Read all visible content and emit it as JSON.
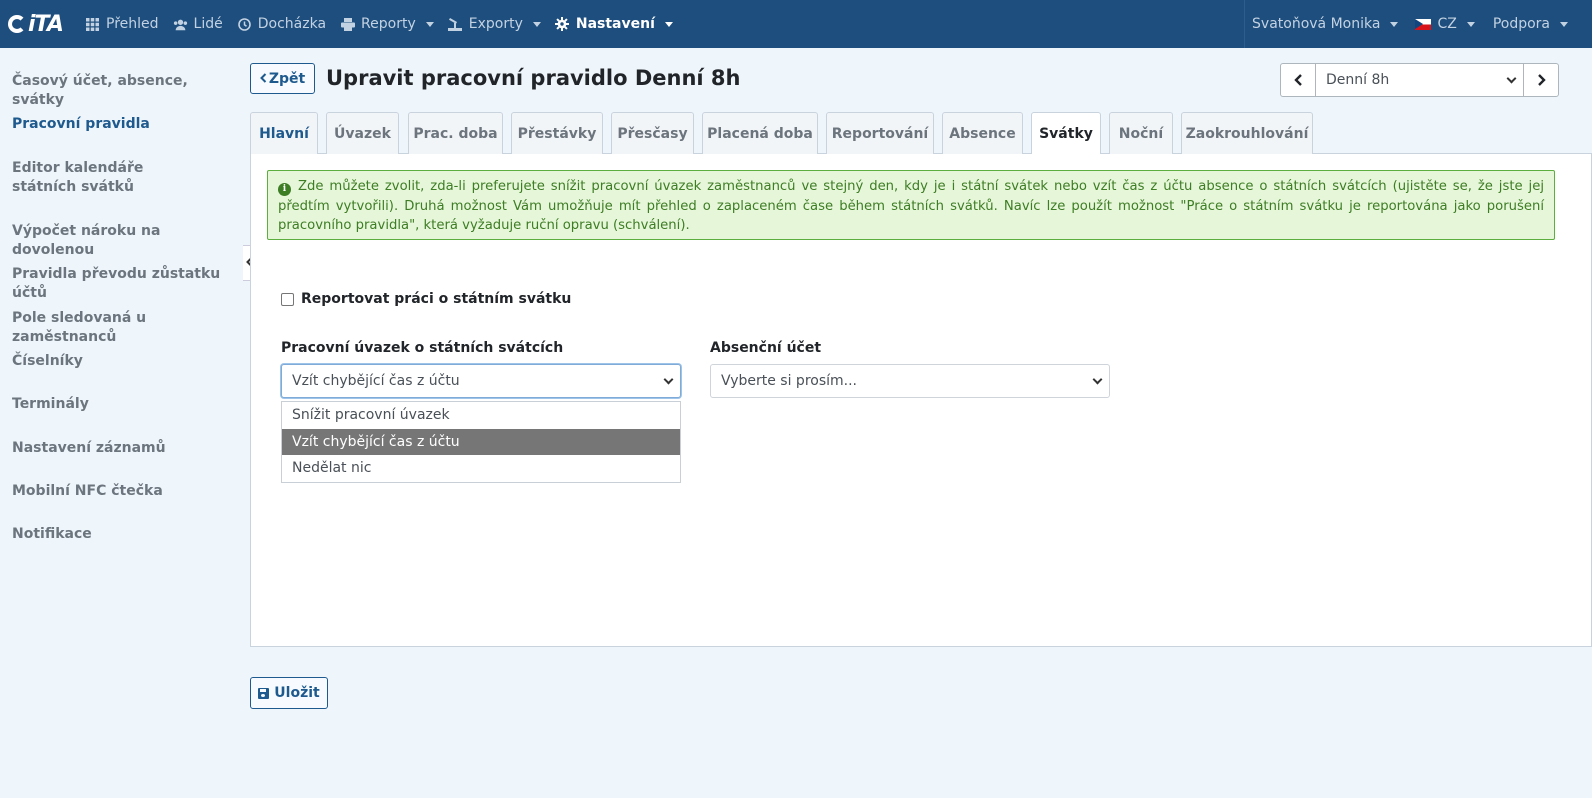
{
  "app": {
    "logo_text": "iTA"
  },
  "navbar": {
    "items": [
      {
        "label": "Přehled",
        "icon": "grid-icon"
      },
      {
        "label": "Lidé",
        "icon": "users-icon"
      },
      {
        "label": "Docházka",
        "icon": "clock-icon"
      },
      {
        "label": "Reporty",
        "icon": "printer-icon"
      },
      {
        "label": "Exporty",
        "icon": "export-icon"
      },
      {
        "label": "Nastavení",
        "icon": "gear-icon"
      }
    ],
    "user": "Svatoňová Monika",
    "language": "CZ",
    "support": "Podpora"
  },
  "sidebar": {
    "items": [
      {
        "label": "Časový účet, absence, svátky"
      },
      {
        "label": "Pracovní pravidla"
      },
      {
        "label": "Editor kalendáře státních svátků"
      },
      {
        "label": "Výpočet nároku na dovolenou"
      },
      {
        "label": "Pravidla převodu zůstatku účtů"
      },
      {
        "label": "Pole sledovaná u zaměstnanců"
      },
      {
        "label": "Číselníky"
      },
      {
        "label": "Terminály"
      },
      {
        "label": "Nastavení záznamů"
      },
      {
        "label": "Mobilní NFC čtečka"
      },
      {
        "label": "Notifikace"
      }
    ]
  },
  "header": {
    "back_label": "Zpět",
    "title": "Upravit pracovní pravidlo Denní 8h",
    "rule_select_value": "Denní 8h"
  },
  "tabs": [
    {
      "label": "Hlavní"
    },
    {
      "label": "Úvazek"
    },
    {
      "label": "Prac. doba"
    },
    {
      "label": "Přestávky"
    },
    {
      "label": "Přesčasy"
    },
    {
      "label": "Placená doba"
    },
    {
      "label": "Reportování"
    },
    {
      "label": "Absence"
    },
    {
      "label": "Svátky"
    },
    {
      "label": "Noční"
    },
    {
      "label": "Zaokrouhlování"
    }
  ],
  "active_tab": "Svátky",
  "panel": {
    "info_text": "Zde můžete zvolit, zda-li preferujete snížit pracovní úvazek zaměstnanců ve stejný den, kdy je i státní svátek nebo vzít čas z účtu absence o státních svátcích (ujistěte se, že jste jej předtím vytvořili). Druhá možnost Vám umožňuje mít přehled o zaplaceném čase během státních svátků. Navíc lze použít možnost \"Práce o státním svátku je reportována jako porušení pracovního pravidla\", která vyžaduje ruční opravu (schválení).",
    "checkbox_label": "Reportovat práci o státním svátku",
    "checkbox_checked": false,
    "workload_label": "Pracovní úvazek o státních svátcích",
    "workload_value": "Vzít chybějící čas z účtu",
    "workload_options": [
      "Snížit pracovní úvazek",
      "Vzít chybějící čas z účtu",
      "Nedělat nic"
    ],
    "absence_label": "Absenční účet",
    "absence_value": "Vyberte si prosím..."
  },
  "save_label": "Uložit",
  "colors": {
    "navbar": "#1e4e7d",
    "accent": "#1f5a8e",
    "alert_bg": "#e6f6d9",
    "alert_text": "#3d7d24",
    "selected_option": "#767676"
  }
}
